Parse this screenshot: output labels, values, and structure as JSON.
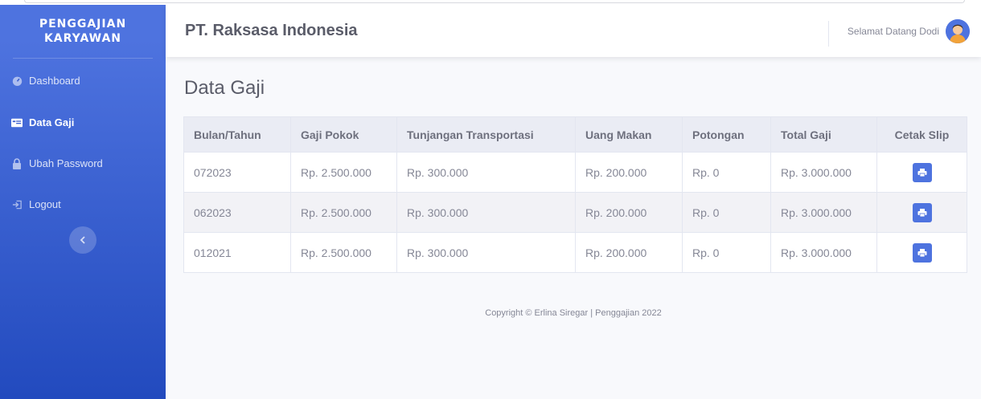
{
  "sidebar": {
    "brand_line1": "PENGGAJIAN",
    "brand_line2": "KARYAWAN",
    "items": [
      {
        "label": "Dashboard",
        "icon": "dashboard-icon"
      },
      {
        "label": "Data Gaji",
        "icon": "card-icon",
        "active": true
      },
      {
        "label": "Ubah Password",
        "icon": "lock-icon"
      },
      {
        "label": "Logout",
        "icon": "logout-icon"
      }
    ],
    "toggle_icon": "chevron-left-icon"
  },
  "topbar": {
    "company": "PT. Raksasa Indonesia",
    "welcome": "Selamat Datang Dodi"
  },
  "page": {
    "title": "Data Gaji"
  },
  "table": {
    "headers": [
      "Bulan/Tahun",
      "Gaji Pokok",
      "Tunjangan Transportasi",
      "Uang Makan",
      "Potongan",
      "Total Gaji",
      "Cetak Slip"
    ],
    "rows": [
      [
        "072023",
        "Rp. 2.500.000",
        "Rp. 300.000",
        "Rp. 200.000",
        "Rp. 0",
        "Rp. 3.000.000"
      ],
      [
        "062023",
        "Rp. 2.500.000",
        "Rp. 300.000",
        "Rp. 200.000",
        "Rp. 0",
        "Rp. 3.000.000"
      ],
      [
        "012021",
        "Rp. 2.500.000",
        "Rp. 300.000",
        "Rp. 200.000",
        "Rp. 0",
        "Rp. 3.000.000"
      ]
    ]
  },
  "footer": {
    "text": "Copyright © Erlina Siregar | Penggajian 2022"
  },
  "colors": {
    "primary": "#4e73df",
    "sidebar_dark": "#224abe"
  }
}
